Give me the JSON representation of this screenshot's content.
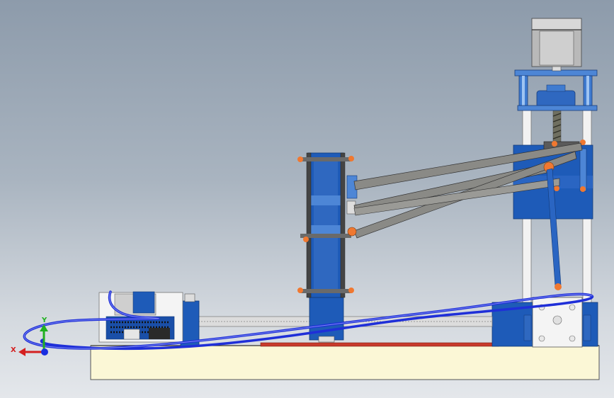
{
  "triad": {
    "x_label": "X",
    "y_label": "Y",
    "x_color": "#d42020",
    "y_color": "#20b020",
    "z_color": "#1a2ee0"
  },
  "colors": {
    "background_top": "#8d9bab",
    "background_bottom": "#e4e7eb",
    "base_plate": "#fbf7d6",
    "part_blue": "#1e5bb8",
    "part_blue_light": "#4d86d6",
    "link_grey": "#8a8a86",
    "cable_blue": "#1f2fd8",
    "accent_orange": "#f07830",
    "red_strip": "#c83a2a",
    "motor_grey": "#c8c8c8"
  },
  "icons": {
    "coordinate_triad": "xyz-axes-icon",
    "stepper_motor": "stepper-motor-icon"
  }
}
